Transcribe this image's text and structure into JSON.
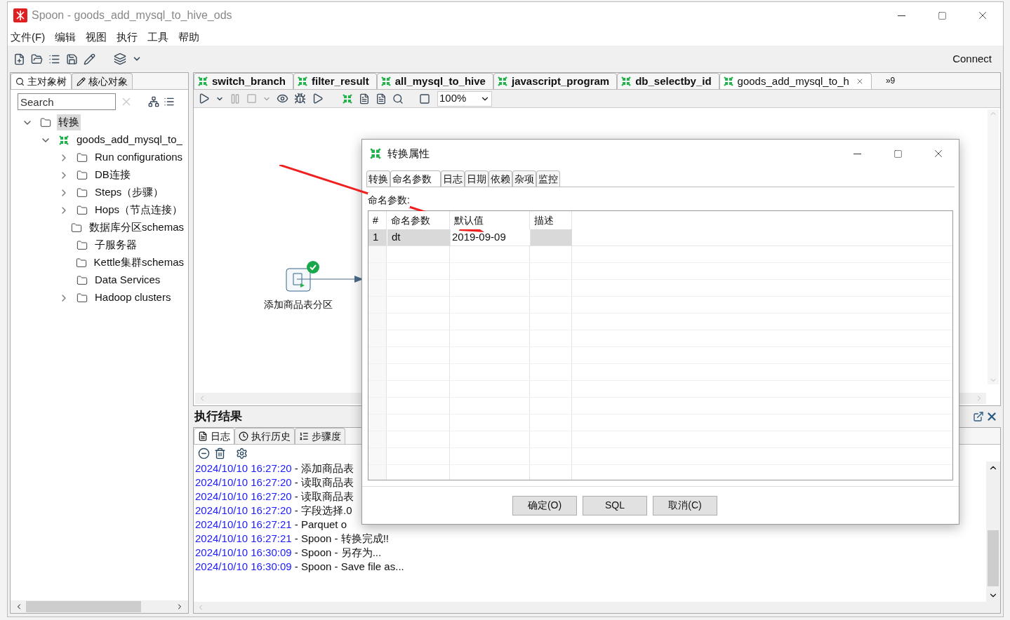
{
  "window": {
    "title": "Spoon - goods_add_mysql_to_hive_ods"
  },
  "menu": [
    "文件(F)",
    "编辑",
    "视图",
    "执行",
    "工具",
    "帮助"
  ],
  "toolbar": {
    "connect": "Connect"
  },
  "left_tabs": [
    {
      "label": "主对象树",
      "selected": true
    },
    {
      "label": "核心对象",
      "selected": false
    }
  ],
  "search": {
    "placeholder": "Search"
  },
  "tree": [
    {
      "label": "转换",
      "kind": "folder",
      "expanded": true,
      "selected": true,
      "children": [
        {
          "label": "goods_add_mysql_to_",
          "kind": "transform",
          "expanded": true,
          "selected": false,
          "children": [
            {
              "label": "Run configurations",
              "kind": "folder",
              "expanded": false,
              "selected": false
            },
            {
              "label": "DB连接",
              "kind": "folder",
              "expanded": false,
              "selected": false
            },
            {
              "label": "Steps（步骤）",
              "kind": "folder",
              "expanded": false,
              "selected": false
            },
            {
              "label": "Hops（节点连接）",
              "kind": "folder",
              "expanded": false,
              "selected": false
            },
            {
              "label": "数据库分区schemas",
              "kind": "empty_folder",
              "selected": false
            },
            {
              "label": "子服务器",
              "kind": "empty_folder",
              "selected": false
            },
            {
              "label": "Kettle集群schemas",
              "kind": "empty_folder",
              "selected": false
            },
            {
              "label": "Data Services",
              "kind": "empty_folder",
              "selected": false
            },
            {
              "label": "Hadoop clusters",
              "kind": "folder",
              "expanded": false,
              "selected": false
            }
          ]
        }
      ]
    }
  ],
  "editor_tabs": [
    {
      "label": "switch_branch",
      "selected": false
    },
    {
      "label": "filter_result",
      "selected": false
    },
    {
      "label": "all_mysql_to_hive",
      "selected": false
    },
    {
      "label": "javascript_program",
      "selected": false
    },
    {
      "label": "db_selectby_id",
      "selected": false
    },
    {
      "label": "goods_add_mysql_to_h",
      "selected": true
    }
  ],
  "editor_tabs_overflow": "»9",
  "zoom": {
    "value": "100%"
  },
  "canvas": {
    "step": {
      "label": "添加商品表分区"
    }
  },
  "results": {
    "title": "执行结果",
    "tabs": [
      {
        "label": "日志",
        "selected": true
      },
      {
        "label": "执行历史",
        "selected": false
      },
      {
        "label": "步骤度",
        "selected": false
      }
    ],
    "log": [
      {
        "time": "2024/10/10 16:27:20",
        "message": " - 添加商品表"
      },
      {
        "time": "2024/10/10 16:27:20",
        "message": " - 读取商品表"
      },
      {
        "time": "2024/10/10 16:27:20",
        "message": " - 读取商品表"
      },
      {
        "time": "2024/10/10 16:27:20",
        "message": " - 字段选择.0"
      },
      {
        "time": "2024/10/10 16:27:21",
        "message": " - Parquet o"
      },
      {
        "time": "2024/10/10 16:27:21",
        "message": " - Spoon - 转换完成!!"
      },
      {
        "time": "2024/10/10 16:30:09",
        "message": " - Spoon - 另存为..."
      },
      {
        "time": "2024/10/10 16:30:09",
        "message": " - Spoon - Save file as..."
      }
    ]
  },
  "dialog": {
    "title": "转换属性",
    "tabs": [
      {
        "label": "转换",
        "selected": false
      },
      {
        "label": "命名参数",
        "selected": true
      },
      {
        "label": "日志",
        "selected": false
      },
      {
        "label": "日期",
        "selected": false
      },
      {
        "label": "依赖",
        "selected": false
      },
      {
        "label": "杂项",
        "selected": false
      },
      {
        "label": "监控",
        "selected": false
      }
    ],
    "section_label": "命名参数:",
    "columns": [
      "#",
      "命名参数",
      "默认值",
      "描述"
    ],
    "rows": [
      {
        "index": "1",
        "name": "dt",
        "default": "2019-09-09"
      }
    ],
    "buttons": [
      "确定(O)",
      "SQL",
      "取消(C)"
    ]
  }
}
